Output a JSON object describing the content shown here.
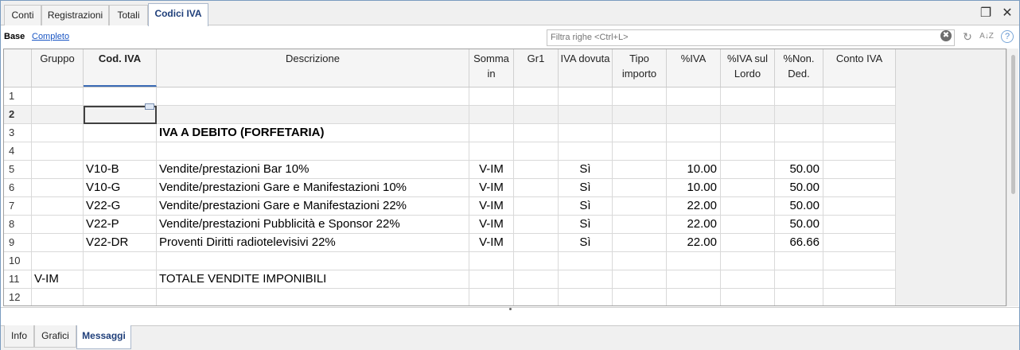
{
  "tabs": [
    {
      "label": "Conti",
      "active": false
    },
    {
      "label": "Registrazioni",
      "active": false
    },
    {
      "label": "Totali",
      "active": false
    },
    {
      "label": "Codici IVA",
      "active": true
    }
  ],
  "window_buttons": {
    "restore_icon": "restore-window-icon",
    "close_icon": "close-icon",
    "restore_glyph": "❐",
    "close_glyph": "✕"
  },
  "views": {
    "base_label": "Base",
    "completo_label": "Completo"
  },
  "filter": {
    "placeholder": "Filtra righe <Ctrl+L>",
    "value": ""
  },
  "toolbar_icons": {
    "clear": "✖",
    "refresh": "↻",
    "sort": "A↓Z",
    "help": "?"
  },
  "columns": [
    {
      "key": "row",
      "label": ""
    },
    {
      "key": "gruppo",
      "label": "Gruppo"
    },
    {
      "key": "cod",
      "label": "Cod. IVA"
    },
    {
      "key": "descr",
      "label": "Descrizione"
    },
    {
      "key": "somma",
      "label": "Somma in"
    },
    {
      "key": "gr1",
      "label": "Gr1"
    },
    {
      "key": "dovuta",
      "label": "IVA dovuta"
    },
    {
      "key": "tipo",
      "label": "Tipo importo"
    },
    {
      "key": "piva",
      "label": "%IVA"
    },
    {
      "key": "lordo",
      "label": "%IVA sul Lordo"
    },
    {
      "key": "nonded",
      "label": "%Non. Ded."
    },
    {
      "key": "conto",
      "label": "Conto IVA"
    }
  ],
  "rows": [
    {
      "n": "1",
      "gruppo": "",
      "cod": "",
      "descr": "",
      "somma": "",
      "gr1": "",
      "dovuta": "",
      "tipo": "",
      "piva": "",
      "lordo": "",
      "nonded": "",
      "conto": ""
    },
    {
      "n": "2",
      "gruppo": "",
      "cod": "",
      "descr": "",
      "somma": "",
      "gr1": "",
      "dovuta": "",
      "tipo": "",
      "piva": "",
      "lordo": "",
      "nonded": "",
      "conto": ""
    },
    {
      "n": "3",
      "gruppo": "",
      "cod": "",
      "descr": "IVA A DEBITO (FORFETARIA)",
      "somma": "",
      "gr1": "",
      "dovuta": "",
      "tipo": "",
      "piva": "",
      "lordo": "",
      "nonded": "",
      "conto": ""
    },
    {
      "n": "4",
      "gruppo": "",
      "cod": "",
      "descr": "",
      "somma": "",
      "gr1": "",
      "dovuta": "",
      "tipo": "",
      "piva": "",
      "lordo": "",
      "nonded": "",
      "conto": ""
    },
    {
      "n": "5",
      "gruppo": "",
      "cod": "V10-B",
      "descr": "Vendite/prestazioni Bar 10%",
      "somma": "V-IM",
      "gr1": "",
      "dovuta": "Sì",
      "tipo": "",
      "piva": "10.00",
      "lordo": "",
      "nonded": "50.00",
      "conto": ""
    },
    {
      "n": "6",
      "gruppo": "",
      "cod": "V10-G",
      "descr": "Vendite/prestazioni Gare e Manifestazioni 10%",
      "somma": "V-IM",
      "gr1": "",
      "dovuta": "Sì",
      "tipo": "",
      "piva": "10.00",
      "lordo": "",
      "nonded": "50.00",
      "conto": ""
    },
    {
      "n": "7",
      "gruppo": "",
      "cod": "V22-G",
      "descr": "Vendite/prestazioni Gare e Manifestazioni 22%",
      "somma": "V-IM",
      "gr1": "",
      "dovuta": "Sì",
      "tipo": "",
      "piva": "22.00",
      "lordo": "",
      "nonded": "50.00",
      "conto": ""
    },
    {
      "n": "8",
      "gruppo": "",
      "cod": "V22-P",
      "descr": "Vendite/prestazioni Pubblicità e Sponsor 22%",
      "somma": "V-IM",
      "gr1": "",
      "dovuta": "Sì",
      "tipo": "",
      "piva": "22.00",
      "lordo": "",
      "nonded": "50.00",
      "conto": ""
    },
    {
      "n": "9",
      "gruppo": "",
      "cod": "V22-DR",
      "descr": "Proventi Diritti radiotelevisivi 22%",
      "somma": "V-IM",
      "gr1": "",
      "dovuta": "Sì",
      "tipo": "",
      "piva": "22.00",
      "lordo": "",
      "nonded": "66.66",
      "conto": ""
    },
    {
      "n": "10",
      "gruppo": "",
      "cod": "",
      "descr": "",
      "somma": "",
      "gr1": "",
      "dovuta": "",
      "tipo": "",
      "piva": "",
      "lordo": "",
      "nonded": "",
      "conto": ""
    },
    {
      "n": "11",
      "gruppo": "V-IM",
      "cod": "",
      "descr": "TOTALE VENDITE IMPONIBILI",
      "somma": "",
      "gr1": "",
      "dovuta": "",
      "tipo": "",
      "piva": "",
      "lordo": "",
      "nonded": "",
      "conto": ""
    },
    {
      "n": "12",
      "gruppo": "",
      "cod": "",
      "descr": "",
      "somma": "",
      "gr1": "",
      "dovuta": "",
      "tipo": "",
      "piva": "",
      "lordo": "",
      "nonded": "",
      "conto": ""
    }
  ],
  "bottom_tabs": [
    {
      "label": "Info",
      "active": false
    },
    {
      "label": "Grafici",
      "active": false
    },
    {
      "label": "Messaggi",
      "active": true
    }
  ]
}
